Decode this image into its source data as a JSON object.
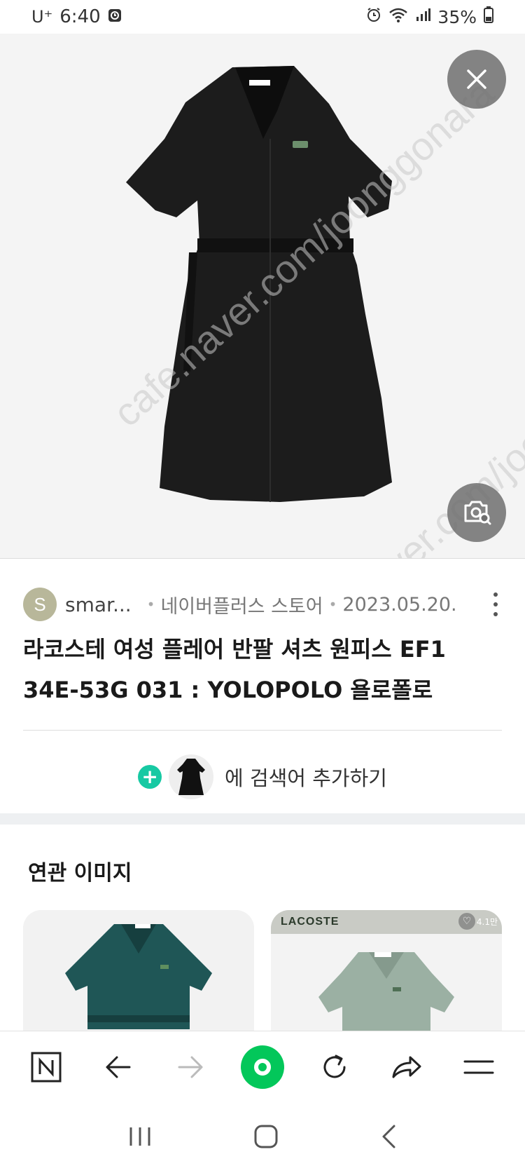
{
  "status_bar": {
    "carrier": "U⁺",
    "time": "6:40",
    "battery": "35%",
    "icons": [
      "clock-icon",
      "alarm-icon",
      "wifi-icon",
      "signal-icon",
      "battery-icon"
    ]
  },
  "hero": {
    "watermark": "cafe.naver.com/joonggonara",
    "close_icon": "close-icon",
    "lens_icon": "image-search-icon"
  },
  "post": {
    "avatar_letter": "S",
    "seller": "smar...",
    "source": "네이버플러스 스토어",
    "date": "2023.05.20.",
    "title_line1": "라코스테 여성 플레어 반팔 셔츠 원피스 EF1",
    "title_line2": "34E-53G 031 : YOLOPOLO 욜로폴로",
    "add_search_label": "에 검색어 추가하기"
  },
  "related": {
    "title": "연관 이미지",
    "card2_brand": "LACOSTE",
    "card2_count": "4.1만"
  },
  "toolbar": {
    "items": [
      "naver-n-icon",
      "back-arrow-icon",
      "forward-arrow-icon",
      "green-dot-icon",
      "refresh-icon",
      "share-icon",
      "menu-icon"
    ]
  },
  "colors": {
    "accent_green": "#03c75a",
    "plus_teal": "#17c9a3",
    "avatar": "#b8b79a"
  }
}
